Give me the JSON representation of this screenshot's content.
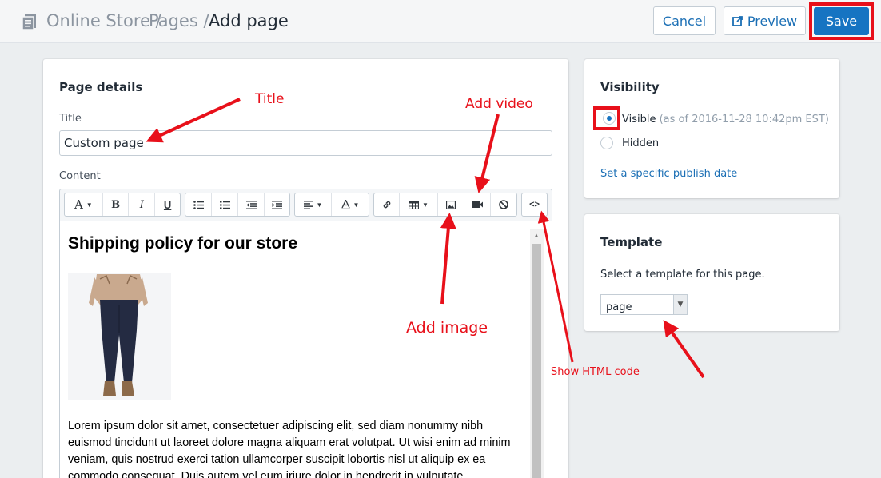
{
  "header": {
    "breadcrumb": [
      "Online Store",
      "Pages"
    ],
    "separator": "/",
    "current": "Add page",
    "cancel_label": "Cancel",
    "preview_label": "Preview",
    "save_label": "Save"
  },
  "page_details": {
    "heading": "Page details",
    "title_label": "Title",
    "title_value": "Custom page",
    "content_label": "Content"
  },
  "toolbar": {
    "font_label": "A",
    "bold": "B",
    "italic": "I",
    "underline": "U",
    "html_code": "<>"
  },
  "editor": {
    "heading": "Shipping policy for our store",
    "paragraph": "Lorem ipsum dolor sit amet, consectetuer adipiscing elit, sed diam nonummy nibh euismod tincidunt ut laoreet dolore magna aliquam erat volutpat. Ut wisi enim ad minim veniam, quis nostrud exerci tation ullamcorper suscipit lobortis nisl ut aliquip ex ea commodo consequat. Duis autem vel eum iriure dolor in hendrerit in vulputate"
  },
  "visibility": {
    "heading": "Visibility",
    "visible_label": "Visible",
    "visible_note": "(as of 2016-11-28 10:42pm EST)",
    "hidden_label": "Hidden",
    "publish_link": "Set a specific publish date"
  },
  "template": {
    "heading": "Template",
    "description": "Select a template for this page.",
    "selected": "page"
  },
  "annotations": {
    "title": "Title",
    "add_video": "Add video",
    "add_image": "Add image",
    "show_html": "Show HTML code"
  },
  "colors": {
    "annotation_red": "#e8101a",
    "primary_blue": "#1674c2"
  }
}
